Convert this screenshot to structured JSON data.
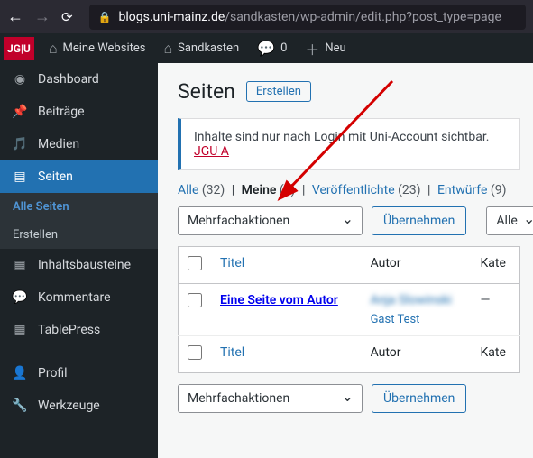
{
  "browser": {
    "url_host": "blogs.uni-mainz.de",
    "url_path": "/sandkasten/wp-admin/edit.php?post_type=page"
  },
  "adminbar": {
    "jgu": "JG|U",
    "mysites": "Meine Websites",
    "sitename": "Sandkasten",
    "comments_count": "0",
    "new": "Neu"
  },
  "sidebar": {
    "dashboard": "Dashboard",
    "posts": "Beiträge",
    "media": "Medien",
    "pages": "Seiten",
    "pages_sub_all": "Alle Seiten",
    "pages_sub_create": "Erstellen",
    "blocks": "Inhaltsbausteine",
    "comments": "Kommentare",
    "tablepress": "TablePress",
    "profile": "Profil",
    "tools": "Werkzeuge"
  },
  "content": {
    "title": "Seiten",
    "create": "Erstellen",
    "notice_text": "Inhalte sind nur nach Login mit Uni-Account sichtbar. ",
    "notice_link": "JGU A",
    "filters": {
      "all": "Alle",
      "all_count": "(32)",
      "mine": "Meine",
      "mine_count": "(1)",
      "published": "Veröffentlichte",
      "published_count": "(23)",
      "drafts": "Entwürfe",
      "drafts_count": "(9)"
    },
    "bulk_label": "Mehrfachaktionen",
    "apply": "Übernehmen",
    "filter_all": "Alle",
    "columns": {
      "title": "Titel",
      "author": "Autor",
      "categories": "Kate"
    },
    "rows": [
      {
        "title": "Eine Seite vom Autor",
        "author_main": "Anja Slowinski",
        "author_sub": "Gast Test",
        "cats": "—"
      }
    ]
  }
}
